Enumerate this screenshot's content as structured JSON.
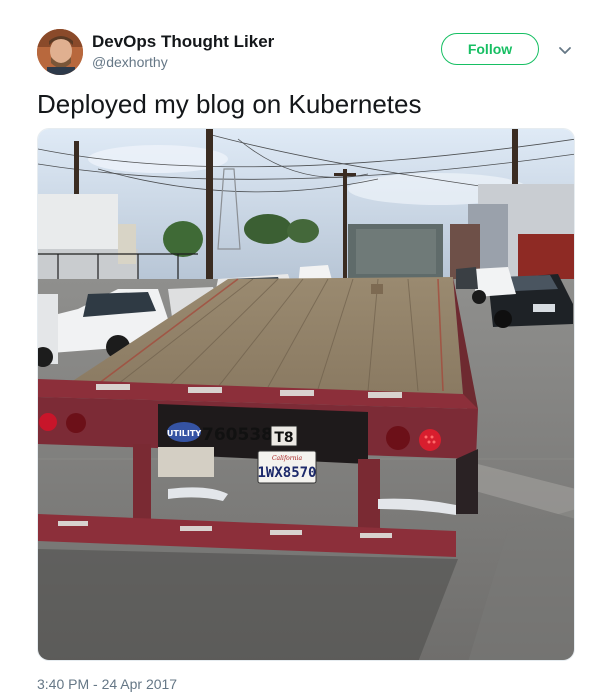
{
  "author": {
    "display_name": "DevOps Thought Liker",
    "handle": "@dexhorthy",
    "avatar_icon": "user-avatar"
  },
  "actions": {
    "follow_label": "Follow",
    "menu_icon": "chevron-down-icon",
    "accent_color": "#17bf63"
  },
  "tweet": {
    "text": "Deployed my blog on Kubernetes",
    "timestamp": "3:40 PM - 24 Apr 2017"
  },
  "photo": {
    "trailer_number": "760538",
    "trailer_badge": "T8",
    "plate_state": "California",
    "plate_number": "1WX8570",
    "logo_text": "UTILITY"
  }
}
